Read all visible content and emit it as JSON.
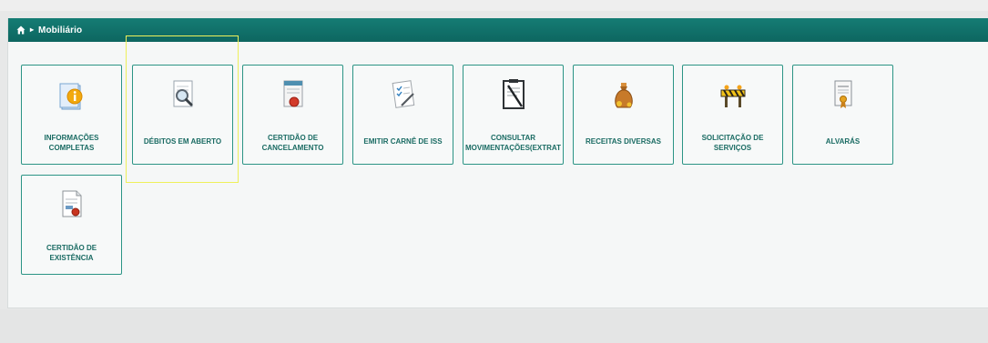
{
  "breadcrumb": {
    "section": "Mobiliário"
  },
  "tiles": [
    {
      "label": "INFORMAÇÕES\nCOMPLETAS",
      "icon": "info-icon"
    },
    {
      "label": "DÉBITOS EM ABERTO",
      "icon": "magnifier-document-icon"
    },
    {
      "label": "CERTIDÃO DE\nCANCELAMENTO",
      "icon": "certificate-seal-icon"
    },
    {
      "label": "EMITIR CARNÊ DE ISS",
      "icon": "checklist-pen-icon"
    },
    {
      "label": "CONSULTAR\nMOVIMENTAÇÕES(EXTRAT",
      "icon": "clipboard-pen-icon"
    },
    {
      "label": "RECEITAS DIVERSAS",
      "icon": "money-bag-icon"
    },
    {
      "label": "SOLICITAÇÃO DE\nSERVIÇOS",
      "icon": "construction-barrier-icon"
    },
    {
      "label": "ALVARÁS",
      "icon": "license-ribbon-icon"
    },
    {
      "label": "CERTIDÃO DE\nEXISTÊNCIA",
      "icon": "certificate-document-icon"
    }
  ],
  "colors": {
    "header": "#0f6e67",
    "tile_border": "#2b9485",
    "label": "#1a6b63",
    "highlight": "#eef05a"
  }
}
